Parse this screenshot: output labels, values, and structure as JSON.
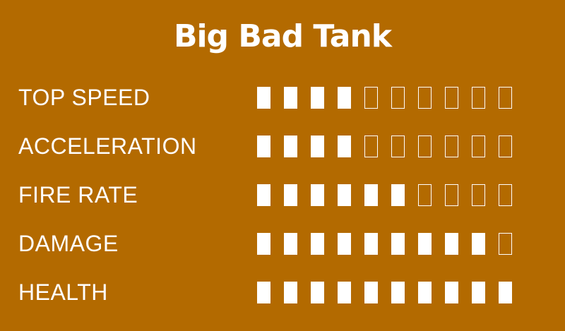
{
  "title": "Big Bad Tank",
  "max_level": 10,
  "stats": [
    {
      "label": "TOP SPEED",
      "level": 4
    },
    {
      "label": "ACCELERATION",
      "level": 4
    },
    {
      "label": "FIRE RATE",
      "level": 6
    },
    {
      "label": "DAMAGE",
      "level": 9
    },
    {
      "label": "HEALTH",
      "level": 10
    }
  ],
  "colors": {
    "background": "#b36a00",
    "text": "#ffffff",
    "pip_filled": "#ffffff",
    "pip_empty_outline": "#ffffff"
  }
}
